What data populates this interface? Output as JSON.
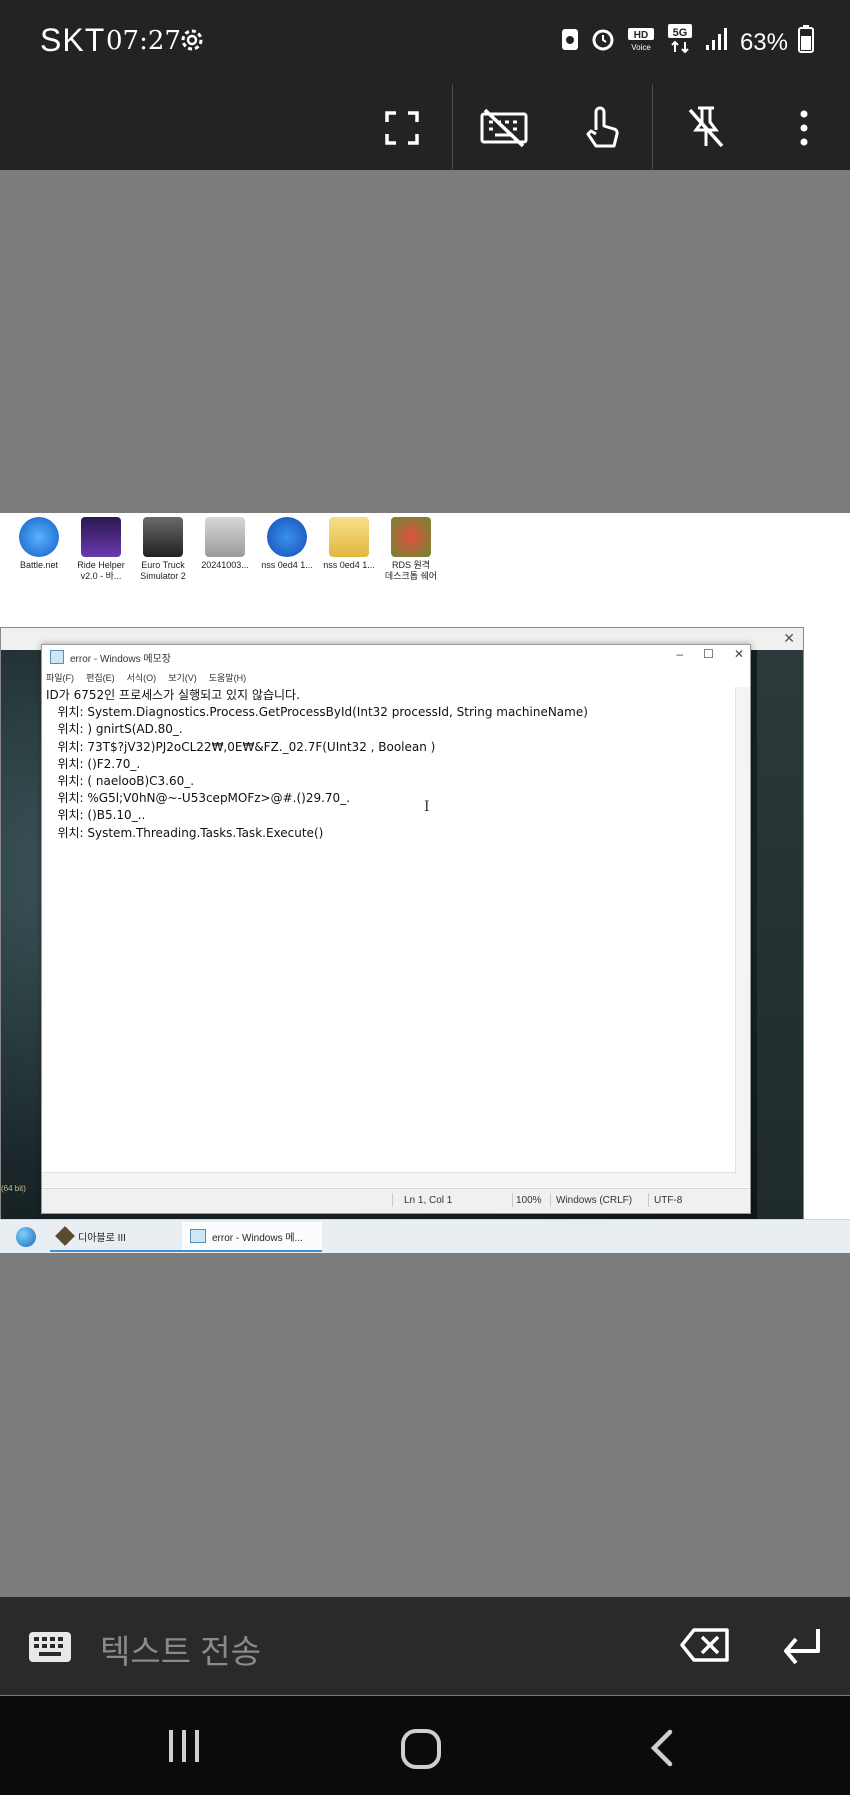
{
  "status_bar": {
    "carrier": "SKT",
    "time": "07:27",
    "battery": "63%"
  },
  "toolbar": {
    "icons": [
      "fullscreen-icon",
      "keyboard-off-icon",
      "touch-icon",
      "unpin-icon",
      "more-icon"
    ]
  },
  "desktop": {
    "icons": [
      {
        "label": "Battle.net"
      },
      {
        "label": "Ride Helper\nv2.0 - 바..."
      },
      {
        "label": "Euro Truck\nSimulator 2"
      },
      {
        "label": "20241003..."
      },
      {
        "label": "nss 0ed4 1..."
      },
      {
        "label": "nss 0ed4 1..."
      },
      {
        "label": "RDS 원격\n데스크톱 쉐어"
      }
    ]
  },
  "notepad": {
    "title": "error - Windows 메모장",
    "menu": [
      "파일(F)",
      "편집(E)",
      "서식(O)",
      "보기(V)",
      "도움말(H)"
    ],
    "lines": [
      "ID가 6752인 프로세스가 실행되고 있지 않습니다.",
      "   위치: System.Diagnostics.Process.GetProcessById(Int32 processId, String machineName)",
      "   위치: ) gnirtS(AD.80_.",
      "   위치: 73T$?jV32)PJ2oCL22₩,0E₩&FZ._02.7F(UInt32 , Boolean )",
      "   위치: ()F2.70_.",
      "   위치: ( naelooB)C3.60_.",
      "   위치: %G5l;V0hN@~-U53cepMOFz>@#.()29.70_.",
      "   위치: ()B5.10_..",
      "   위치: System.Threading.Tasks.Task.Execute()"
    ],
    "status": {
      "position": "Ln 1, Col 1",
      "zoom": "100%",
      "line_ending": "Windows (CRLF)",
      "encoding": "UTF-8"
    }
  },
  "game_window": {
    "side_text": "(64 bit)"
  },
  "taskbar": {
    "items": [
      {
        "label": "디아블로 III"
      },
      {
        "label": "error - Windows 메..."
      }
    ]
  },
  "input_bar": {
    "placeholder": "텍스트 전송"
  },
  "nav_bar": {
    "buttons": [
      "recents-icon",
      "home-icon",
      "back-icon"
    ]
  }
}
